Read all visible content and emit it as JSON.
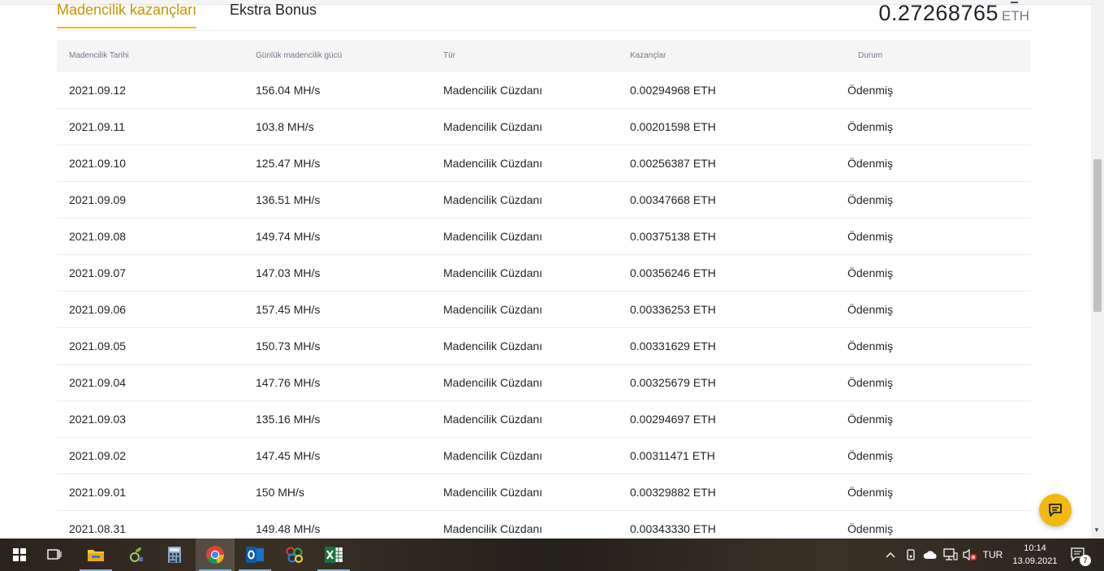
{
  "tabs": {
    "active_label": "Madencilik kazançları",
    "extra_label": "Ekstra Bonus"
  },
  "total": {
    "value": "0.27268765",
    "currency": "ETH"
  },
  "table": {
    "headers": [
      "Madencilik Tarihi",
      "Günlük madencilik gücü",
      "Tür",
      "Kazançlar",
      "Durum"
    ],
    "rows": [
      [
        "2021.09.12",
        "156.04 MH/s",
        "Madencilik Cüzdanı",
        "0.00294968 ETH",
        "Ödenmiş"
      ],
      [
        "2021.09.11",
        "103.8 MH/s",
        "Madencilik Cüzdanı",
        "0.00201598 ETH",
        "Ödenmiş"
      ],
      [
        "2021.09.10",
        "125.47 MH/s",
        "Madencilik Cüzdanı",
        "0.00256387 ETH",
        "Ödenmiş"
      ],
      [
        "2021.09.09",
        "136.51 MH/s",
        "Madencilik Cüzdanı",
        "0.00347668 ETH",
        "Ödenmiş"
      ],
      [
        "2021.09.08",
        "149.74 MH/s",
        "Madencilik Cüzdanı",
        "0.00375138 ETH",
        "Ödenmiş"
      ],
      [
        "2021.09.07",
        "147.03 MH/s",
        "Madencilik Cüzdanı",
        "0.00356246 ETH",
        "Ödenmiş"
      ],
      [
        "2021.09.06",
        "157.45 MH/s",
        "Madencilik Cüzdanı",
        "0.00336253 ETH",
        "Ödenmiş"
      ],
      [
        "2021.09.05",
        "150.73 MH/s",
        "Madencilik Cüzdanı",
        "0.00331629 ETH",
        "Ödenmiş"
      ],
      [
        "2021.09.04",
        "147.76 MH/s",
        "Madencilik Cüzdanı",
        "0.00325679 ETH",
        "Ödenmiş"
      ],
      [
        "2021.09.03",
        "135.16 MH/s",
        "Madencilik Cüzdanı",
        "0.00294697 ETH",
        "Ödenmiş"
      ],
      [
        "2021.09.02",
        "147.45 MH/s",
        "Madencilik Cüzdanı",
        "0.00311471 ETH",
        "Ödenmiş"
      ],
      [
        "2021.09.01",
        "150 MH/s",
        "Madencilik Cüzdanı",
        "0.00329882 ETH",
        "Ödenmiş"
      ],
      [
        "2021.08.31",
        "149.48 MH/s",
        "Madencilik Cüzdanı",
        "0.00343330 ETH",
        "Ödenmiş"
      ]
    ]
  },
  "taskbar": {
    "apps": [
      "windows-start-icon",
      "task-view-icon",
      "file-explorer-icon",
      "plant-app-icon",
      "calculator-icon",
      "chrome-icon",
      "outlook-icon",
      "colorful-app-icon",
      "excel-icon"
    ],
    "language": "TUR",
    "time": "10:14",
    "date": "13.09.2021",
    "notification_count": "7"
  },
  "colors": {
    "accent": "#f0b90b",
    "accent_text": "#c99400",
    "header_bg": "#f5f5f5"
  }
}
